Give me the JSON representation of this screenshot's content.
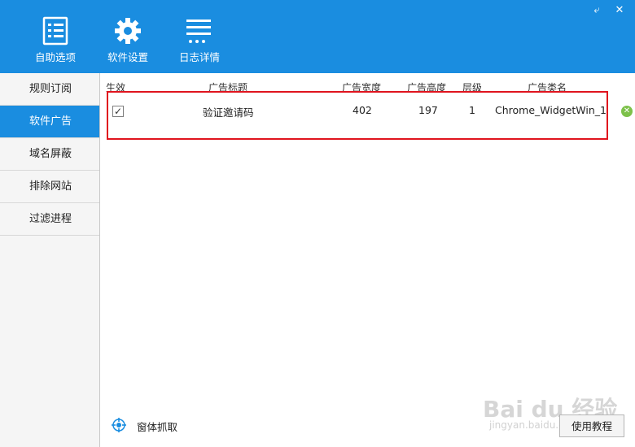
{
  "window": {
    "restore_glyph": "⤶",
    "close_glyph": "✕"
  },
  "nav": [
    {
      "label": "自助选项",
      "icon": "checklist-icon"
    },
    {
      "label": "软件设置",
      "icon": "gear-icon"
    },
    {
      "label": "日志详情",
      "icon": "log-list-icon"
    }
  ],
  "sidebar": {
    "items": [
      {
        "label": "规则订阅",
        "active": false
      },
      {
        "label": "软件广告",
        "active": true
      },
      {
        "label": "域名屏蔽",
        "active": false
      },
      {
        "label": "排除网站",
        "active": false
      },
      {
        "label": "过滤进程",
        "active": false
      }
    ]
  },
  "table": {
    "headers": [
      "生效",
      "广告标题",
      "广告宽度",
      "广告高度",
      "层级",
      "广告类名"
    ],
    "rows": [
      {
        "enabled": true,
        "title": "验证邀请码",
        "width": "402",
        "height": "197",
        "level": "1",
        "class_name": "Chrome_WidgetWin_1"
      }
    ]
  },
  "footer": {
    "grab_label": "窗体抓取",
    "help_label": "使用教程"
  },
  "watermark": {
    "main": "Bai du 经验",
    "sub": "jingyan.baidu.com"
  },
  "colors": {
    "accent": "#1a8de0",
    "highlight": "#e0141e",
    "delete": "#7dc14a"
  }
}
